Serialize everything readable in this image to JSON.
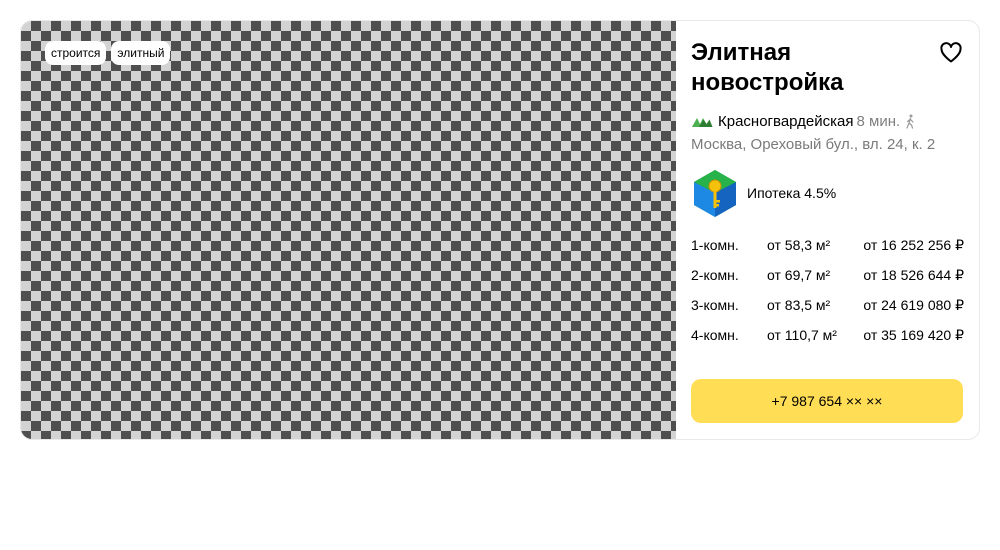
{
  "tags": [
    "строится",
    "элитный"
  ],
  "title": "Элитная новостройка",
  "favorite_icon": "heart-icon",
  "metro": {
    "icon": "metro-logo-icon",
    "station": "Красногвардейская",
    "time": "8 мин.",
    "transport_icon": "walk-icon"
  },
  "address": "Москва, Ореховый бул., вл. 24, к. 2",
  "mortgage": {
    "icon": "bank-logo-icon",
    "label": "Ипотека 4.5%"
  },
  "rooms": [
    {
      "type": "1-комн.",
      "area": "от 58,3 м²",
      "price": "от 16 252 256 ₽"
    },
    {
      "type": "2-комн.",
      "area": "от 69,7 м²",
      "price": "от 18 526 644 ₽"
    },
    {
      "type": "3-комн.",
      "area": "от 83,5 м²",
      "price": "от 24 619 080 ₽"
    },
    {
      "type": "4-комн.",
      "area": "от 110,7 м²",
      "price": "от 35 169 420 ₽"
    }
  ],
  "phone_button": "+7 987 654 ×× ××",
  "colors": {
    "accent_button": "#ffdd55",
    "secondary_text": "#7a7a7a",
    "metro_line": "#4caf50"
  }
}
